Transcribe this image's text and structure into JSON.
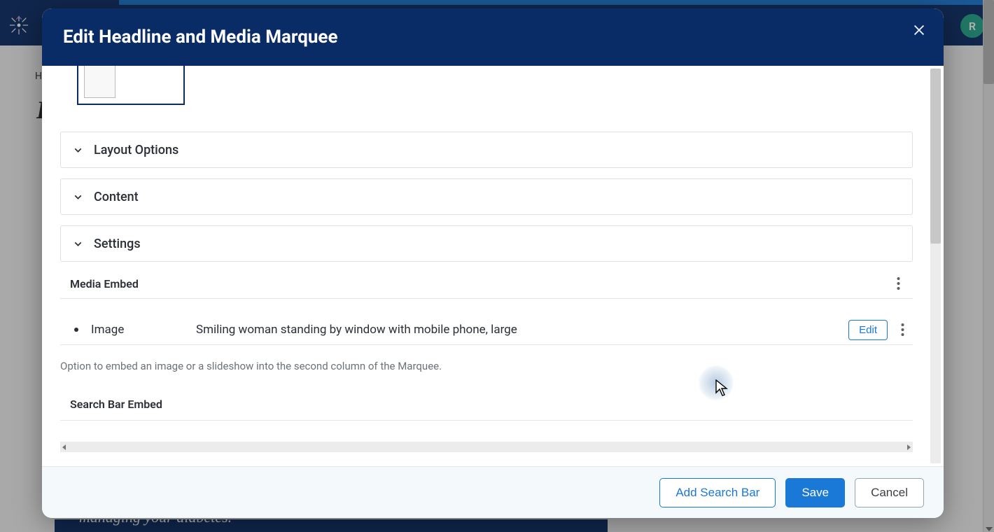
{
  "bg": {
    "avatar_initial": "R",
    "crumb": "H",
    "title_fragment": "E",
    "strip_text": "managing your diabetes."
  },
  "modal": {
    "title": "Edit Headline and Media Marquee",
    "sections": {
      "layout": "Layout Options",
      "content": "Content",
      "settings": "Settings"
    },
    "media": {
      "heading": "Media Embed",
      "item_label": "Image",
      "item_desc": "Smiling woman standing by window with mobile phone, large",
      "edit_label": "Edit",
      "help": "Option to embed an image or a slideshow into the second column of the Marquee."
    },
    "search": {
      "heading": "Search Bar Embed"
    },
    "footer": {
      "add_search": "Add Search Bar",
      "save": "Save",
      "cancel": "Cancel"
    }
  }
}
